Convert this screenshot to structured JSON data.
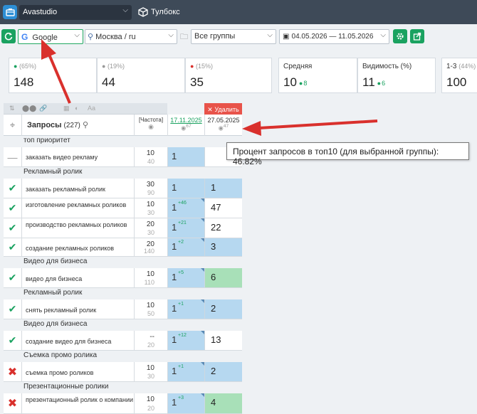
{
  "topbar": {
    "project": "Avastudio",
    "tools": "Тулбокс"
  },
  "toolbar": {
    "engine": "Google",
    "region": "Москва / ru",
    "groups": "Все группы",
    "dates": "04.05.2026 — 11.05.2026"
  },
  "cards": [
    {
      "label": "(65%)",
      "value": "148",
      "icon": "up-arrow-icon",
      "color": "#1aa260"
    },
    {
      "label": "(19%)",
      "value": "44",
      "icon": "minus-icon",
      "color": "#999"
    },
    {
      "label": "(15%)",
      "value": "35",
      "icon": "down-arrow-icon",
      "color": "#d9302c"
    },
    {
      "label": "Средняя",
      "value": "10",
      "delta": "8"
    },
    {
      "label": "Видимость (%)",
      "value": "11",
      "delta": "6"
    },
    {
      "label": "1-3",
      "sub": "(44%)",
      "value": "100"
    }
  ],
  "table": {
    "delete_label": "✕ Удалить",
    "queries_label": "Запросы",
    "queries_count": "(227)",
    "freq_label": "[Частота]",
    "date1": "17.11.2025",
    "date1_sub": "67",
    "date2": "27.05.2025",
    "date2_sub": "47"
  },
  "tooltip": "Процент запросов в топ10 (для выбранной группы): 46.82%",
  "groups": [
    "топ приоритет",
    "Рекламный ролик",
    "Видео для бизнеса",
    "Рекламный ролик",
    "Видео для бизнеса",
    "Съемка промо ролика",
    "Презентационные ролики"
  ],
  "rows": [
    {
      "q": "заказать видео рекламу",
      "f1": "10",
      "f2": "40",
      "p1": "1",
      "d1": "",
      "p2": "",
      "st": "none"
    },
    {
      "q": "заказать рекламный ролик",
      "f1": "30",
      "f2": "90",
      "p1": "1",
      "d1": "",
      "p2": "1",
      "st": "ok"
    },
    {
      "q": "изготовление рекламных роликов",
      "f1": "10",
      "f2": "30",
      "p1": "1",
      "d1": "+46",
      "p2": "47",
      "st": "ok"
    },
    {
      "q": "производство рекламных роликов",
      "f1": "20",
      "f2": "30",
      "p1": "1",
      "d1": "+21",
      "p2": "22",
      "st": "ok"
    },
    {
      "q": "создание рекламных роликов",
      "f1": "20",
      "f2": "140",
      "p1": "1",
      "d1": "+2",
      "p2": "3",
      "st": "ok"
    },
    {
      "q": "видео для бизнеса",
      "f1": "10",
      "f2": "110",
      "p1": "1",
      "d1": "+5",
      "p2": "6",
      "st": "ok"
    },
    {
      "q": "снять рекламный ролик",
      "f1": "10",
      "f2": "50",
      "p1": "1",
      "d1": "+1",
      "p2": "2",
      "st": "ok"
    },
    {
      "q": "создание видео для бизнеса",
      "f1": "--",
      "f2": "20",
      "p1": "1",
      "d1": "+12",
      "p2": "13",
      "st": "ok"
    },
    {
      "q": "съемка промо роликов",
      "f1": "10",
      "f2": "30",
      "p1": "1",
      "d1": "+1",
      "p2": "2",
      "st": "bad"
    },
    {
      "q": "презентационный ролик о компании",
      "f1": "10",
      "f2": "20",
      "p1": "1",
      "d1": "+3",
      "p2": "4",
      "st": "bad"
    }
  ]
}
